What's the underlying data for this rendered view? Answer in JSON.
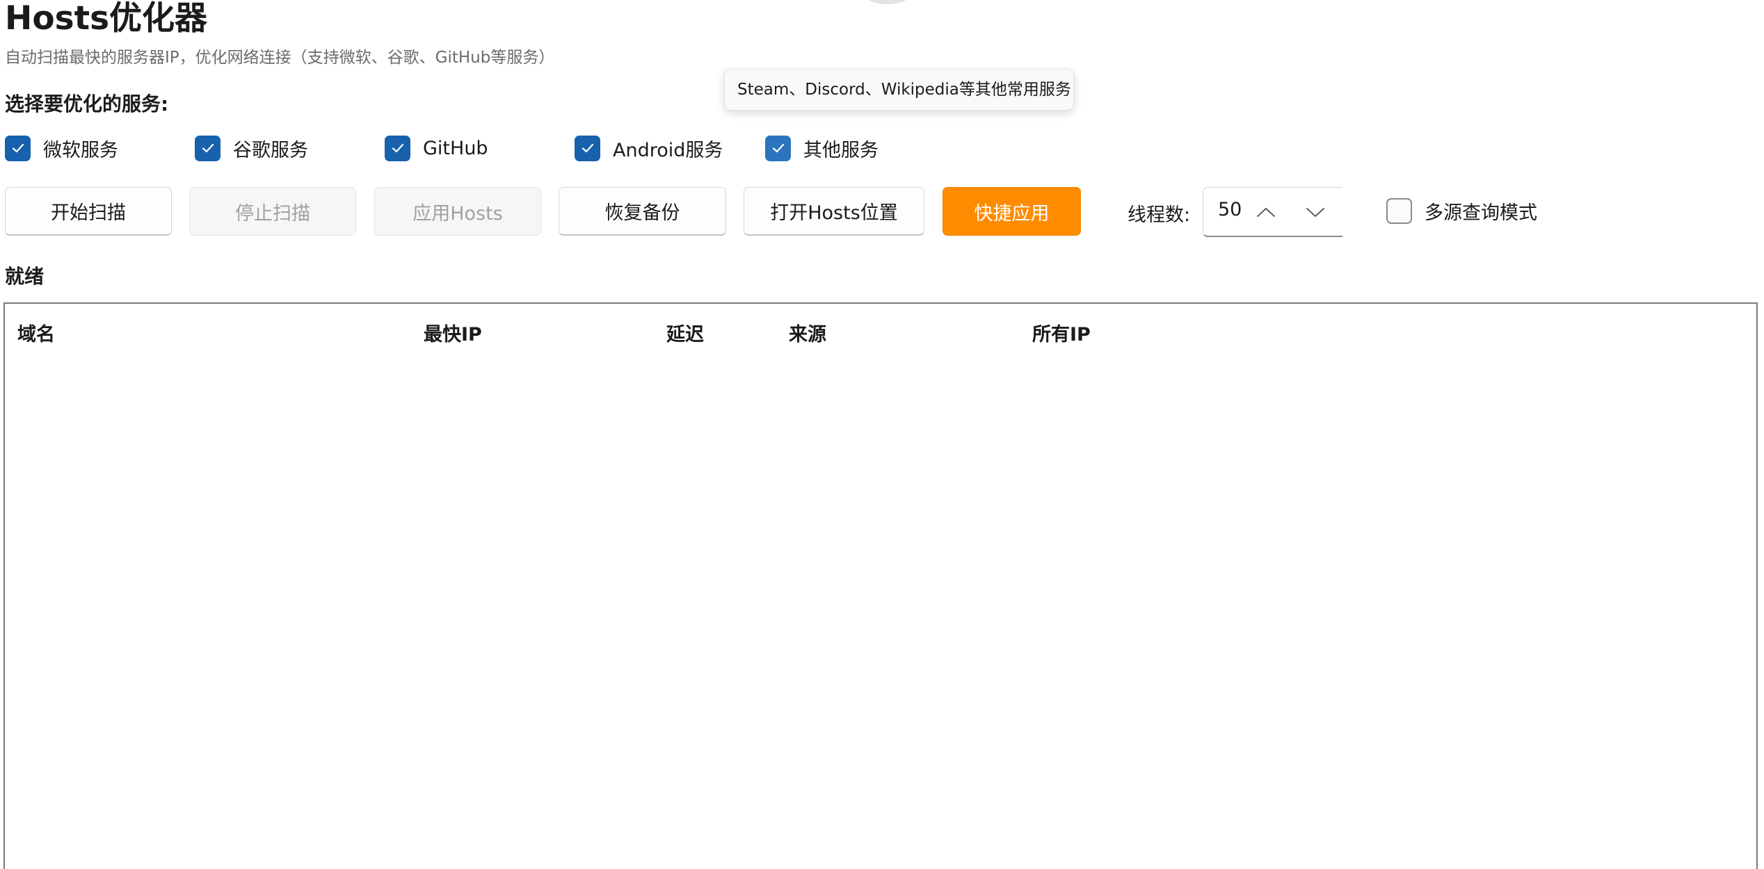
{
  "app": {
    "title": "Hosts优化器",
    "subtitle": "自动扫描最快的服务器IP，优化网络连接（支持微软、谷歌、GitHub等服务）"
  },
  "services": {
    "label": "选择要优化的服务:",
    "items": [
      {
        "label": "微软服务",
        "checked": true
      },
      {
        "label": "谷歌服务",
        "checked": true
      },
      {
        "label": "GitHub",
        "checked": true
      },
      {
        "label": "Android服务",
        "checked": true
      },
      {
        "label": "其他服务",
        "checked": true
      }
    ],
    "tooltip": "Steam、Discord、Wikipedia等其他常用服务"
  },
  "toolbar": {
    "start_scan": "开始扫描",
    "stop_scan": "停止扫描",
    "apply_hosts": "应用Hosts",
    "restore_backup": "恢复备份",
    "open_hosts_location": "打开Hosts位置",
    "quick_apply": "快捷应用",
    "threads_label": "线程数:",
    "threads_value": "50",
    "multi_source_label": "多源查询模式",
    "multi_source_checked": false
  },
  "status": {
    "text": "就绪"
  },
  "table": {
    "columns": [
      "域名",
      "最快IP",
      "延迟",
      "来源",
      "所有IP"
    ],
    "rows": []
  },
  "colors": {
    "accent": "#ff8c00",
    "checkbox": "#1761ad"
  }
}
